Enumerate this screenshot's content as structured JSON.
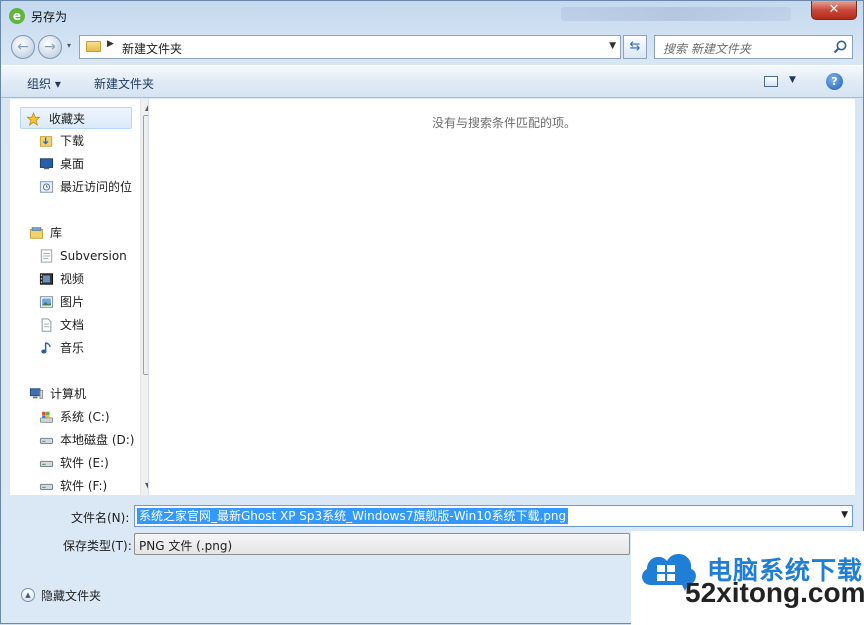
{
  "window": {
    "title": "另存为",
    "close_symbol": "✕"
  },
  "nav": {
    "back_icon": "back-arrow-icon",
    "forward_icon": "forward-arrow-icon",
    "address_path": "新建文件夹",
    "search_placeholder": "搜索 新建文件夹"
  },
  "toolbar": {
    "organize_label": "组织 ▾",
    "new_folder_label": "新建文件夹"
  },
  "sidebar": {
    "items": [
      {
        "label": "收藏夹",
        "icon": "star-icon"
      },
      {
        "label": "下载",
        "icon": "download-folder-icon"
      },
      {
        "label": "桌面",
        "icon": "desktop-icon"
      },
      {
        "label": "最近访问的位",
        "icon": "recent-places-icon"
      },
      {
        "label": "库",
        "icon": "library-icon"
      },
      {
        "label": "Subversion",
        "icon": "library-doc-icon"
      },
      {
        "label": "视频",
        "icon": "video-icon"
      },
      {
        "label": "图片",
        "icon": "picture-icon"
      },
      {
        "label": "文档",
        "icon": "document-icon"
      },
      {
        "label": "音乐",
        "icon": "music-icon"
      },
      {
        "label": "计算机",
        "icon": "computer-icon"
      },
      {
        "label": "系统 (C:)",
        "icon": "system-drive-icon"
      },
      {
        "label": "本地磁盘 (D:)",
        "icon": "drive-icon"
      },
      {
        "label": "软件 (E:)",
        "icon": "drive-icon"
      },
      {
        "label": "软件 (F:)",
        "icon": "drive-icon"
      }
    ]
  },
  "content": {
    "empty_message": "没有与搜索条件匹配的项。"
  },
  "form": {
    "filename_label": "文件名(N):",
    "filename_value": "系统之家官网_最新Ghost XP Sp3系统_Windows7旗舰版-Win10系统下载.png",
    "filetype_label": "保存类型(T):",
    "filetype_value": "PNG 文件 (.png)"
  },
  "footer": {
    "hide_folders_label": "隐藏文件夹"
  },
  "watermark": {
    "title": "电脑系统下载",
    "domain": "52xitong.com"
  },
  "colors": {
    "accent": "#1f7ed6",
    "selection": "#3399ff",
    "close_button": "#c9493a"
  }
}
